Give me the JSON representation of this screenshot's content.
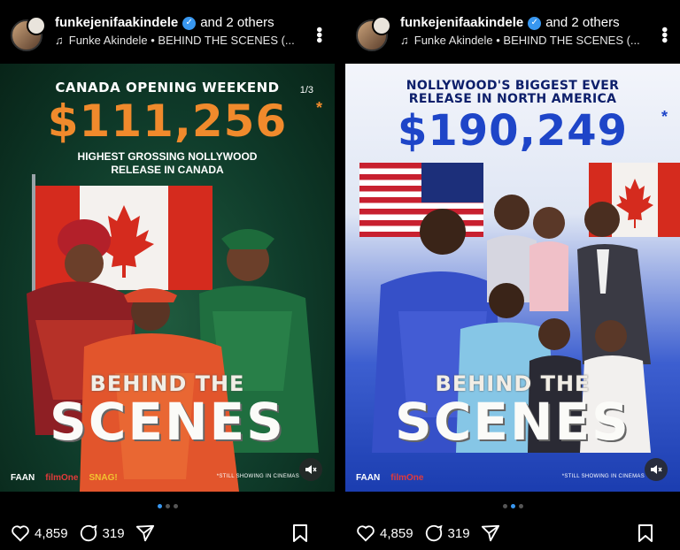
{
  "posts": [
    {
      "header": {
        "username": "funkejenifaakindele",
        "collab": "and 2 others",
        "audio": "Funke Akindele • BEHIND THE SCENES (..."
      },
      "media": {
        "headline": "CANADA OPENING WEEKEND",
        "amount": "$111,256",
        "asterisk": "*",
        "counter": "1/3",
        "subline1": "HIGHEST GROSSING NOLLYWOOD",
        "subline2": "RELEASE IN CANADA",
        "title_small": "BEHIND THE",
        "title_big": "SCENES",
        "logo1": "FAAN",
        "logo2": "filmOne",
        "logo3": "SNAG!",
        "still_showing": "*STILL SHOWING IN CINEMAS"
      },
      "carousel": {
        "count": 3,
        "active": 0
      },
      "actions": {
        "likes": "4,859",
        "comments": "319"
      }
    },
    {
      "header": {
        "username": "funkejenifaakindele",
        "collab": "and 2 others",
        "audio": "Funke Akindele • BEHIND THE SCENES (..."
      },
      "media": {
        "headline1": "NOLLYWOOD'S BIGGEST EVER",
        "headline2": "RELEASE IN NORTH AMERICA",
        "amount": "$190,249",
        "asterisk": "*",
        "title_small": "BEHIND THE",
        "title_big": "SCENES",
        "logo1": "FAAN",
        "logo2": "filmOne",
        "still_showing": "*STILL SHOWING IN CINEMAS"
      },
      "carousel": {
        "count": 3,
        "active": 1
      },
      "actions": {
        "likes": "4,859",
        "comments": "319"
      }
    }
  ],
  "colors": {
    "verified": "#3897f0",
    "left_amount": "#f08a2c",
    "right_amount": "#1e45c8",
    "active_dot": "#3897f0"
  }
}
